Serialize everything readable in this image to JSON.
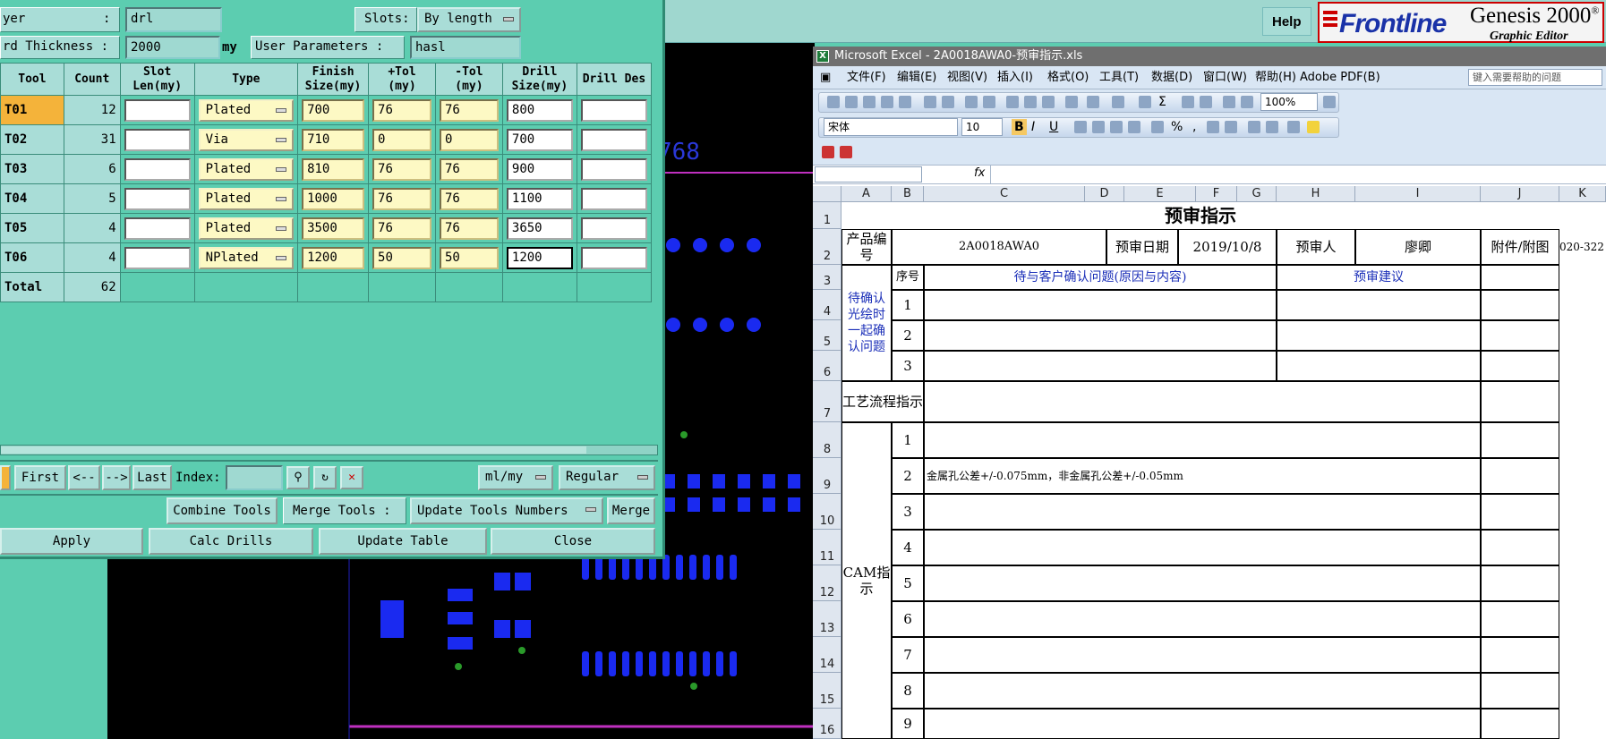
{
  "genesis": {
    "help_label": "Help",
    "logo_text": "Frontline",
    "product": "Genesis 2000",
    "product_suffix": "®",
    "subtitle": "Graphic Editor",
    "canvas_text": "768"
  },
  "dialog": {
    "layer_label": "yer",
    "layer_colon": ":",
    "layer_value": "drl",
    "slots_label": "Slots:",
    "slots_value": "By length",
    "thickness_label": "rd Thickness :",
    "thickness_value": "2000",
    "thickness_unit": "my",
    "user_params_label": "User Parameters :",
    "user_params_value": "hasl",
    "columns": [
      "Tool",
      "Count",
      "Slot Len(my)",
      "Type",
      "Finish Size(my)",
      "+Tol (my)",
      "-Tol (my)",
      "Drill Size(my)",
      "Drill Des"
    ],
    "rows": [
      {
        "tool": "T01",
        "count": "12",
        "slot": "",
        "type": "Plated",
        "finish": "700",
        "ptol": "76",
        "ntol": "76",
        "drill": "800",
        "des": ""
      },
      {
        "tool": "T02",
        "count": "31",
        "slot": "",
        "type": "Via",
        "finish": "710",
        "ptol": "0",
        "ntol": "0",
        "drill": "700",
        "des": ""
      },
      {
        "tool": "T03",
        "count": "6",
        "slot": "",
        "type": "Plated",
        "finish": "810",
        "ptol": "76",
        "ntol": "76",
        "drill": "900",
        "des": ""
      },
      {
        "tool": "T04",
        "count": "5",
        "slot": "",
        "type": "Plated",
        "finish": "1000",
        "ptol": "76",
        "ntol": "76",
        "drill": "1100",
        "des": ""
      },
      {
        "tool": "T05",
        "count": "4",
        "slot": "",
        "type": "Plated",
        "finish": "3500",
        "ptol": "76",
        "ntol": "76",
        "drill": "3650",
        "des": ""
      },
      {
        "tool": "T06",
        "count": "4",
        "slot": "",
        "type": "NPlated",
        "finish": "1200",
        "ptol": "50",
        "ntol": "50",
        "drill": "1200",
        "des": ""
      }
    ],
    "total_label": "Total",
    "total_value": "62",
    "nav": {
      "first": "First",
      "prev": "<--",
      "next": "-->",
      "last": "Last",
      "index_label": "Index:",
      "units": "ml/my",
      "mode": "Regular"
    },
    "tools_row": {
      "combine": "Combine Tools",
      "merge_label": "Merge Tools :",
      "update_numbers": "Update Tools Numbers",
      "merge": "Merge"
    },
    "actions": {
      "apply": "Apply",
      "calc": "Calc Drills",
      "update_table": "Update Table",
      "close": "Close"
    }
  },
  "excel": {
    "title": "Microsoft Excel - 2A0018AWA0-预审指示.xls",
    "menus": [
      "文件(F)",
      "编辑(E)",
      "视图(V)",
      "插入(I)",
      "格式(O)",
      "工具(T)",
      "数据(D)",
      "窗口(W)",
      "帮助(H)",
      "Adobe PDF(B)"
    ],
    "help_placeholder": "键入需要帮助的问题",
    "zoom": "100%",
    "font_name": "宋体",
    "font_size": "10",
    "sigma": "Σ",
    "fx": "fx",
    "col_headers": [
      "A",
      "B",
      "C",
      "D",
      "E",
      "F",
      "G",
      "H",
      "I",
      "J",
      "K"
    ],
    "row_headers": [
      "1",
      "2",
      "3",
      "4",
      "5",
      "6",
      "7",
      "8",
      "9",
      "10",
      "11",
      "12",
      "13",
      "14",
      "15",
      "16"
    ],
    "sheet": {
      "title": "预审指示",
      "product_no_label": "产品编号",
      "product_no": "2A0018AWA0",
      "review_date_label": "预审日期",
      "review_date": "2019/10/8",
      "reviewer_label": "预审人",
      "reviewer": "廖卿",
      "attachment_label": "附件/附图",
      "k2_value": "020-322",
      "seq_label": "序号",
      "issue_header": "待与客户确认问题(原因与内容)",
      "suggest_header": "预审建议",
      "confirm_group": "待确认光绘时一起确认问题",
      "confirm_nums": [
        "1",
        "2",
        "3"
      ],
      "process_label": "工艺流程指示",
      "cam_label": "CAM指示",
      "cam_nums": [
        "1",
        "2",
        "3",
        "4",
        "5",
        "6",
        "7",
        "8",
        "9"
      ],
      "cam_item2": "金属孔公差+/-0.075mm，非金属孔公差+/-0.05mm"
    }
  }
}
